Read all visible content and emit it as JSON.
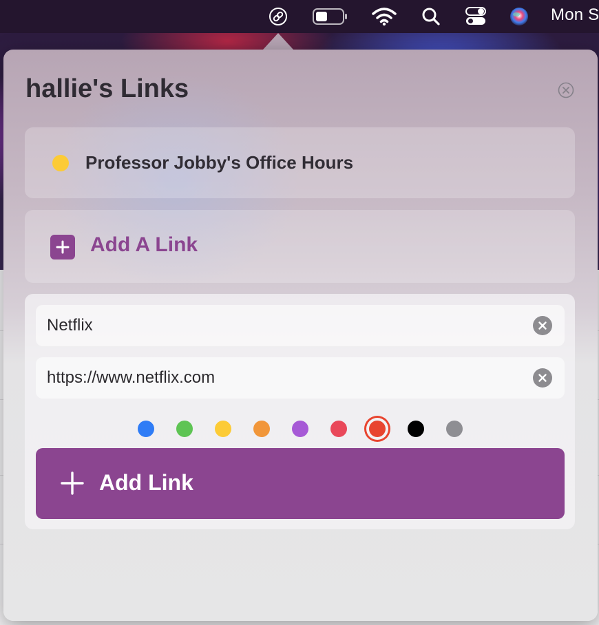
{
  "menubar": {
    "clock": "Mon S",
    "icons": [
      "link-icon",
      "battery-icon",
      "wifi-icon",
      "search-icon",
      "control-center-icon",
      "siri-icon"
    ]
  },
  "popover": {
    "title": "hallie's Links",
    "links": [
      {
        "title": "Professor Jobby's Office Hours",
        "color": "#fccb36"
      }
    ],
    "add_link_label": "Add A Link",
    "form": {
      "name_value": "Netflix",
      "url_value": "https://www.netflix.com",
      "colors": [
        "#2f7cf6",
        "#5ec454",
        "#fccb36",
        "#f1963a",
        "#a659d6",
        "#e9485a",
        "#e8442f",
        "#000000",
        "#8e8e93"
      ],
      "selected_color_index": 6,
      "submit_label": "Add Link"
    }
  },
  "colors": {
    "accent": "#8b4590"
  }
}
